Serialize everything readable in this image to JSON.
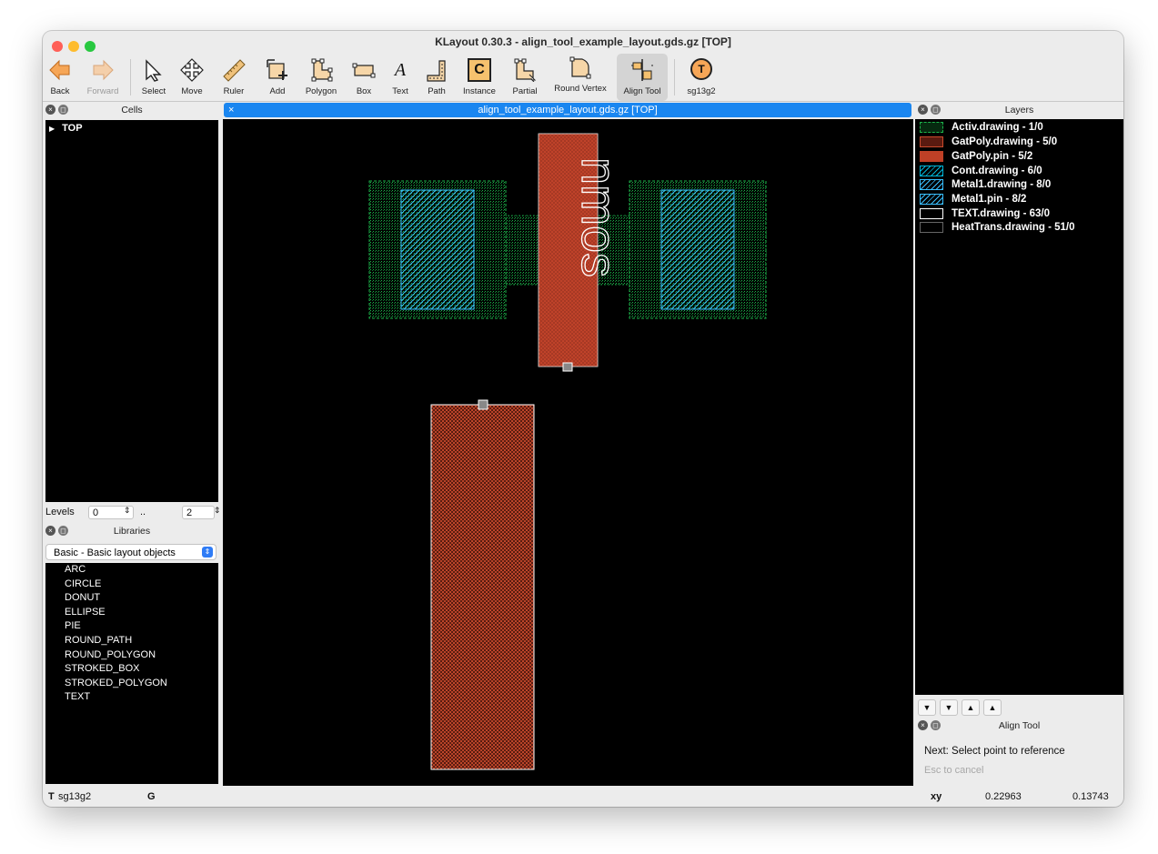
{
  "window": {
    "title": "KLayout 0.30.3 - align_tool_example_layout.gds.gz [TOP]"
  },
  "toolbar": {
    "back": "Back",
    "forward": "Forward",
    "select": "Select",
    "move": "Move",
    "ruler": "Ruler",
    "add": "Add",
    "polygon": "Polygon",
    "box": "Box",
    "text": "Text",
    "text_glyph": "A",
    "path": "Path",
    "instance": "Instance",
    "instance_glyph": "C",
    "partial": "Partial",
    "round_vertex": "Round Vertex",
    "align_tool": "Align Tool",
    "tech": "sg13g2",
    "tech_glyph": "T"
  },
  "cells": {
    "title": "Cells",
    "tree": [
      {
        "label": "TOP"
      }
    ],
    "levels": {
      "label": "Levels",
      "from": "0",
      "sep": "..",
      "to": "2"
    }
  },
  "libraries": {
    "title": "Libraries",
    "selected": "Basic - Basic layout objects",
    "items": [
      "ARC",
      "CIRCLE",
      "DONUT",
      "ELLIPSE",
      "PIE",
      "ROUND_PATH",
      "ROUND_POLYGON",
      "STROKED_BOX",
      "STROKED_POLYGON",
      "TEXT"
    ]
  },
  "canvas": {
    "tab_title": "align_tool_example_layout.gds.gz [TOP]",
    "close_glyph": "×",
    "label_text": "nmos"
  },
  "layers": {
    "title": "Layers",
    "items": [
      {
        "label": "Activ.drawing - 1/0",
        "color": "#1cb34a"
      },
      {
        "label": "GatPoly.drawing - 5/0",
        "color": "#bf4026"
      },
      {
        "label": "GatPoly.pin - 5/2",
        "color": "#bf4026"
      },
      {
        "label": "Cont.drawing - 6/0",
        "color": "#00b5d8"
      },
      {
        "label": "Metal1.drawing - 8/0",
        "color": "#39bfff"
      },
      {
        "label": "Metal1.pin - 8/2",
        "color": "#39bfff"
      },
      {
        "label": "TEXT.drawing - 63/0",
        "color": "#ffffff"
      },
      {
        "label": "HeatTrans.drawing - 51/0",
        "color": "#000000"
      }
    ],
    "buttons": [
      "▼",
      "▼",
      "▲",
      "▲"
    ]
  },
  "align_tool": {
    "title": "Align Tool",
    "message": "Next: Select point to reference",
    "hint": "Esc to cancel"
  },
  "status": {
    "tech_prefix": "T",
    "tech": "sg13g2",
    "grid": "G",
    "xy_label": "xy",
    "x": "0.22963",
    "y": "0.13743"
  },
  "colors": {
    "selection_tab": "#1a86f0",
    "activ": "#1cb34a",
    "gatpoly": "#bf4026",
    "metal1": "#39bfff"
  }
}
